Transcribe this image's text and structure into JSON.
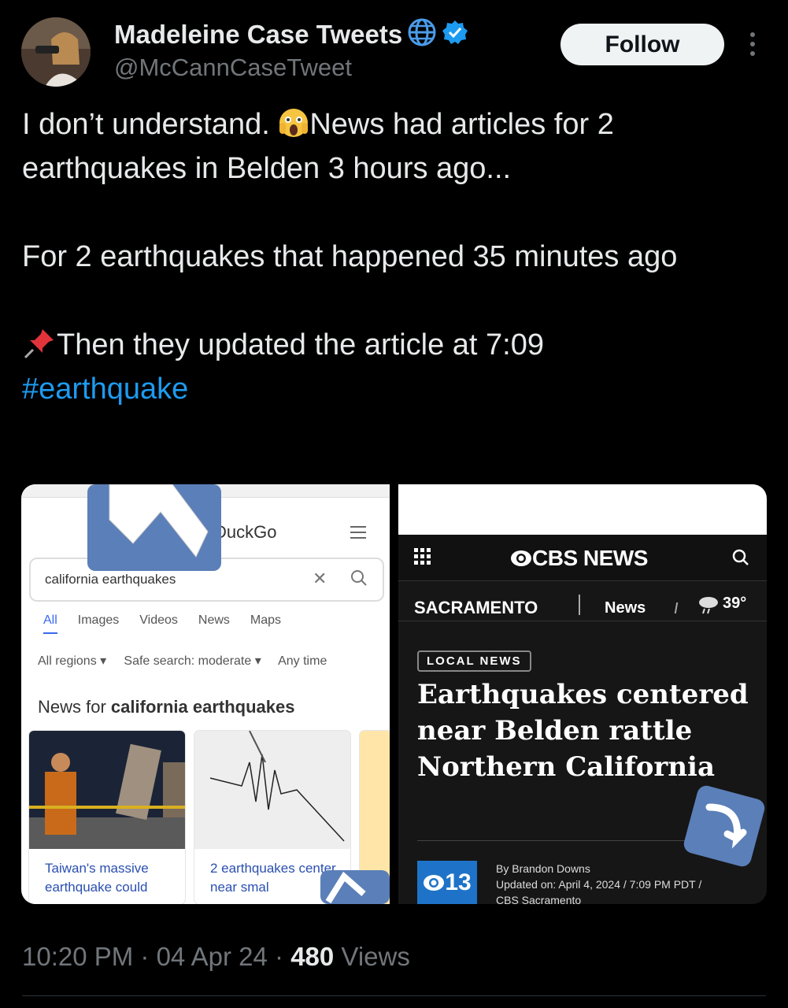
{
  "tweet": {
    "display_name": "Madeleine Case Tweets",
    "handle": "@McCannCaseTweet",
    "follow_label": "Follow",
    "text_line1": "I don’t understand. ",
    "text_line1b": "News had articles for 2 earthquakes in  Belden 3 hours ago...",
    "text_line2": "For 2 earthquakes that happened 35 minutes ago",
    "text_line3": "Then they updated the article at 7:09",
    "hashtag": "#earthquake",
    "timestamp": "10:20 PM · 04 Apr 24 · ",
    "views_count": "480",
    "views_label": " Views"
  },
  "left_screenshot": {
    "brand": "DuckGo",
    "query": "california earthquakes",
    "tabs": [
      "All",
      "Images",
      "Videos",
      "News",
      "Maps"
    ],
    "filters": "All regions ▾     Safe search: moderate ▾     Any time",
    "news_heading_prefix": "News for ",
    "news_heading_query": "california earthquakes",
    "card1_caption": "Taiwan's massive earthquake could",
    "card2_caption": "2 earthquakes center near smal"
  },
  "right_screenshot": {
    "logo": "CBS NEWS",
    "city": "SACRAMENTO",
    "section": "News",
    "temp": "39°",
    "badge": "LOCAL NEWS",
    "headline": "Earthquakes centered near Belden rattle Northern California",
    "station": "13",
    "byline_author": "By Brandon Downs",
    "byline_updated": "Updated on: April 4, 2024 / 7:09 PM PDT /",
    "byline_outlet": "CBS Sacramento"
  },
  "colors": {
    "link": "#1d9bf0",
    "verified": "#1d9bf0",
    "muted": "#71767b"
  },
  "icons": [
    "globe-icon",
    "verified-badge-icon",
    "more-icon",
    "scream-emoji-icon",
    "pushpin-emoji-icon",
    "cursor-arrow-icon"
  ]
}
